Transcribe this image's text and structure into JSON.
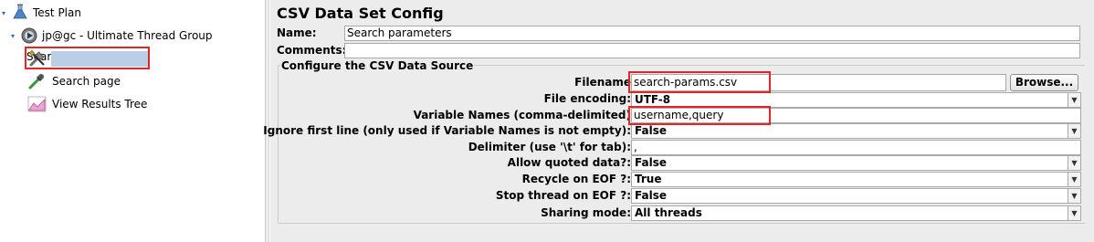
{
  "tree": {
    "nodes": [
      {
        "label": "Test Plan",
        "icon": "flask-icon"
      },
      {
        "label": "jp@gc - Ultimate Thread Group",
        "icon": "gear-icon"
      },
      {
        "label": "Search parameters",
        "icon": "wrench-screwdriver-icon",
        "selected": true
      },
      {
        "label": "Search page",
        "icon": "pipette-icon"
      },
      {
        "label": "View Results Tree",
        "icon": "chart-icon"
      }
    ]
  },
  "panel": {
    "title": "CSV Data Set Config",
    "name_label": "Name:",
    "name_value": "Search parameters",
    "comments_label": "Comments:",
    "comments_value": "",
    "group_title": "Configure the CSV Data Source",
    "browse_label": "Browse...",
    "fields": {
      "filename": {
        "label": "Filename",
        "value": "search-params.csv"
      },
      "encoding": {
        "label": "File encoding:",
        "value": "UTF-8"
      },
      "varnames": {
        "label": "Variable Names (comma-delimited)",
        "value": "username,query"
      },
      "ignore_first": {
        "label": "Ignore first line (only used if Variable Names is not empty):",
        "value": "False"
      },
      "delimiter": {
        "label": "Delimiter (use '\\t' for tab):",
        "value": ","
      },
      "quoted": {
        "label": "Allow quoted data?:",
        "value": "False"
      },
      "recycle": {
        "label": "Recycle on EOF ?:",
        "value": "True"
      },
      "stop_thread": {
        "label": "Stop thread on EOF ?:",
        "value": "False"
      },
      "sharing": {
        "label": "Sharing mode:",
        "value": "All threads"
      }
    }
  },
  "colors": {
    "highlight": "#e0262a",
    "selection": "#b8cfe5",
    "panel_bg": "#ececec"
  }
}
